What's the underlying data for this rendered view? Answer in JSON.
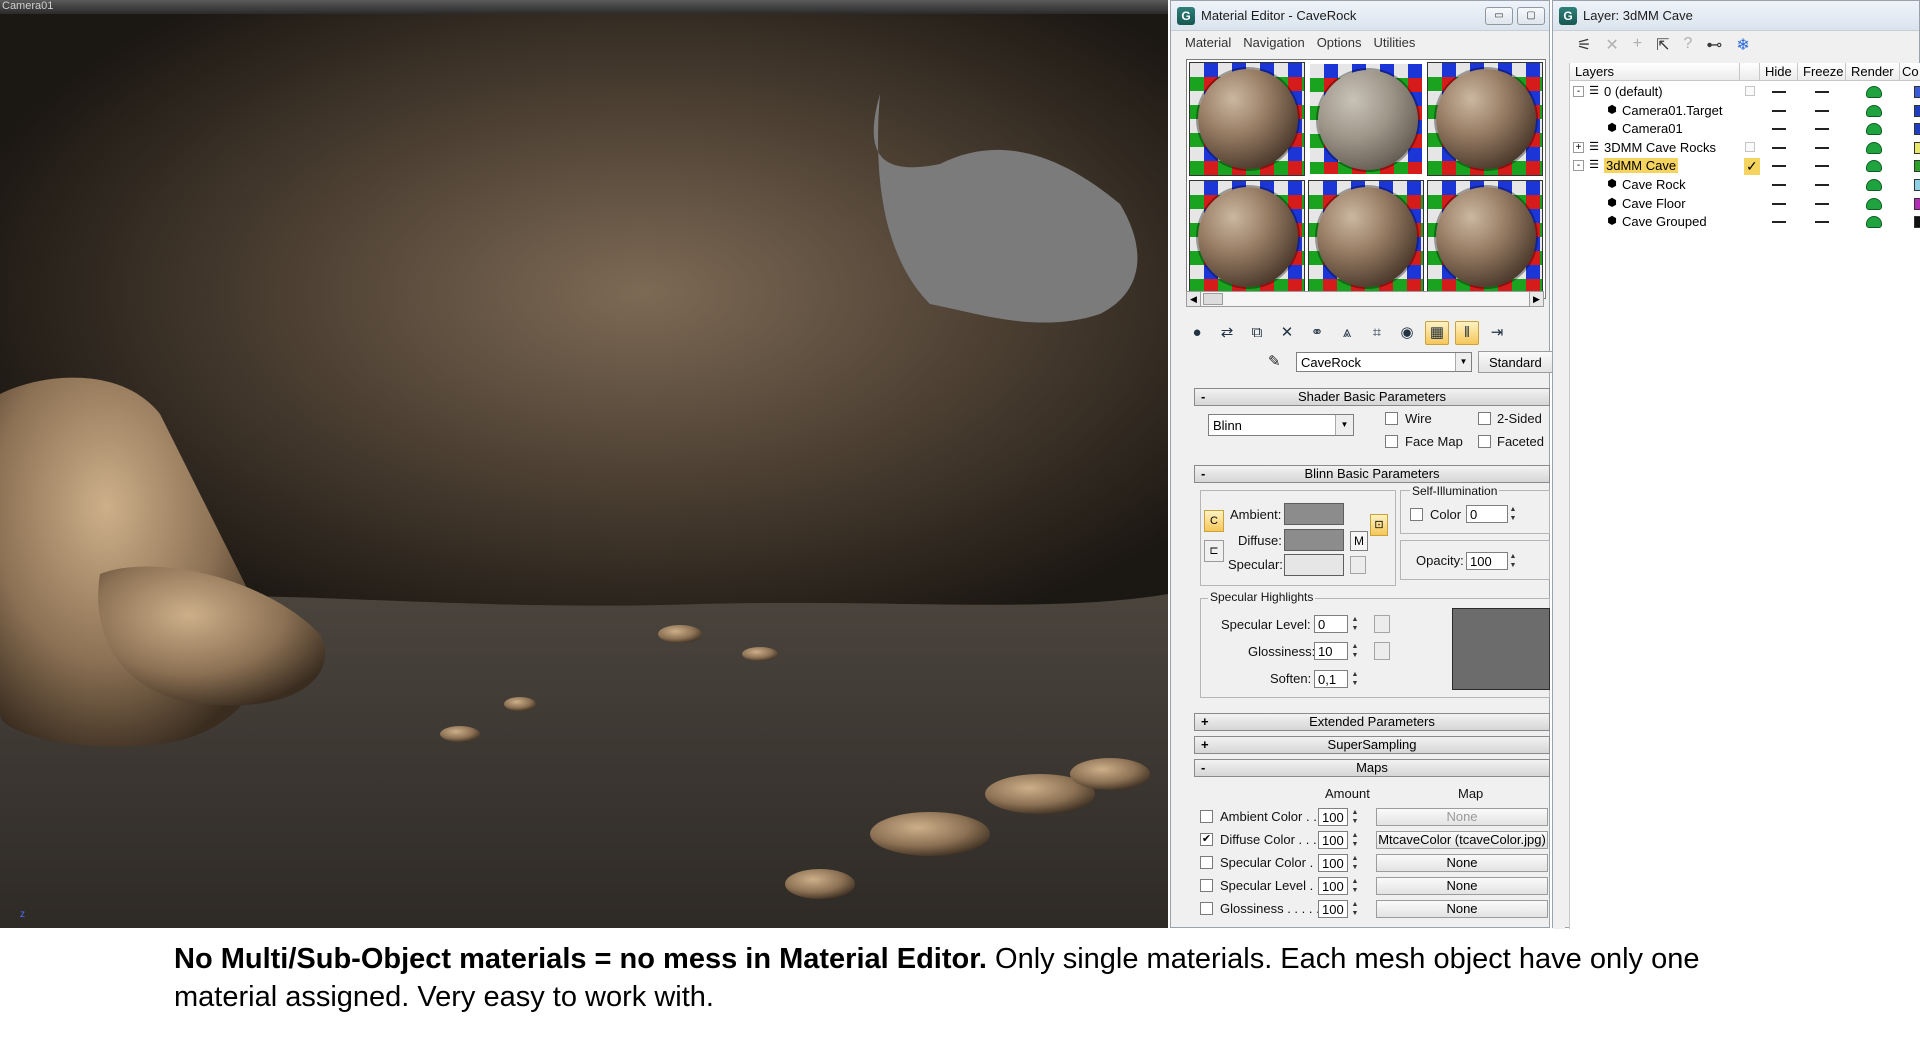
{
  "viewport": {
    "label": "Camera01",
    "axis_label": "z"
  },
  "material_editor": {
    "title": "Material Editor - CaveRock",
    "menu": [
      "Material",
      "Navigation",
      "Options",
      "Utilities"
    ],
    "material_name": "CaveRock",
    "material_type": "Standard",
    "shader_rollout": "Shader Basic Parameters",
    "shader": "Blinn",
    "shader_options": {
      "wire": "Wire",
      "two_sided": "2-Sided",
      "face_map": "Face Map",
      "faceted": "Faceted"
    },
    "blinn_rollout": "Blinn Basic Parameters",
    "colors": {
      "ambient_label": "Ambient:",
      "diffuse_label": "Diffuse:",
      "specular_label": "Specular:",
      "m_label": "M",
      "ambient": "#8c8c8c",
      "diffuse": "#8c8c8c",
      "specular": "#e6e6e6"
    },
    "self_illum": {
      "group": "Self-Illumination",
      "color_label": "Color",
      "value": "0"
    },
    "opacity": {
      "label": "Opacity:",
      "value": "100"
    },
    "specular_highlights": {
      "group": "Specular Highlights",
      "level_label": "Specular Level:",
      "level": "0",
      "gloss_label": "Glossiness:",
      "gloss": "10",
      "soften_label": "Soften:",
      "soften": "0,1"
    },
    "extended_rollout": "Extended Parameters",
    "supersampling_rollout": "SuperSampling",
    "maps_rollout": "Maps",
    "maps_header": {
      "amount": "Amount",
      "map": "Map"
    },
    "maps": [
      {
        "label": "Ambient Color . . .",
        "checked": false,
        "amount": "100",
        "map": "None",
        "dim": true
      },
      {
        "label": "Diffuse Color . . . .",
        "checked": true,
        "amount": "100",
        "map": "MtcaveColor (tcaveColor.jpg)",
        "dim": false
      },
      {
        "label": "Specular Color . .",
        "checked": false,
        "amount": "100",
        "map": "None",
        "dim": false
      },
      {
        "label": "Specular Level  .",
        "checked": false,
        "amount": "100",
        "map": "None",
        "dim": false
      },
      {
        "label": "Glossiness  . . . . .",
        "checked": false,
        "amount": "100",
        "map": "None",
        "dim": false
      }
    ],
    "plus": "+",
    "minus": "-"
  },
  "layer_window": {
    "title": "Layer: 3dMM Cave",
    "columns": [
      "Layers",
      "Hide",
      "Freeze",
      "Render",
      "Co"
    ],
    "rows": [
      {
        "name": "0 (default)",
        "level": 0,
        "expander": "-",
        "kind": "layer",
        "selected": false,
        "current": false,
        "color": "#3b5bdb"
      },
      {
        "name": "Camera01.Target",
        "level": 1,
        "expander": "",
        "kind": "object",
        "selected": false,
        "current": false,
        "color": "#1f3fbf"
      },
      {
        "name": "Camera01",
        "level": 1,
        "expander": "",
        "kind": "object",
        "selected": false,
        "current": false,
        "color": "#1f3fbf"
      },
      {
        "name": "3DMM Cave Rocks",
        "level": 0,
        "expander": "+",
        "kind": "layer",
        "selected": false,
        "current": false,
        "color": "#e7e76a"
      },
      {
        "name": "3dMM Cave",
        "level": 0,
        "expander": "-",
        "kind": "layer",
        "selected": true,
        "current": true,
        "color": "#2ba32b"
      },
      {
        "name": "Cave Rock",
        "level": 1,
        "expander": "",
        "kind": "object",
        "selected": false,
        "current": false,
        "color": "#8fd2e6"
      },
      {
        "name": "Cave Floor",
        "level": 1,
        "expander": "",
        "kind": "object",
        "selected": false,
        "current": false,
        "color": "#b22fb5"
      },
      {
        "name": "Cave Grouped",
        "level": 1,
        "expander": "",
        "kind": "object",
        "selected": false,
        "current": false,
        "color": "#111111"
      }
    ],
    "current_mark": "✓"
  },
  "caption": {
    "bold": "No Multi/Sub-Object materials = no mess in Material Editor.",
    "rest": " Only single materials. Each mesh object have only one material assigned. Very easy to work with."
  }
}
